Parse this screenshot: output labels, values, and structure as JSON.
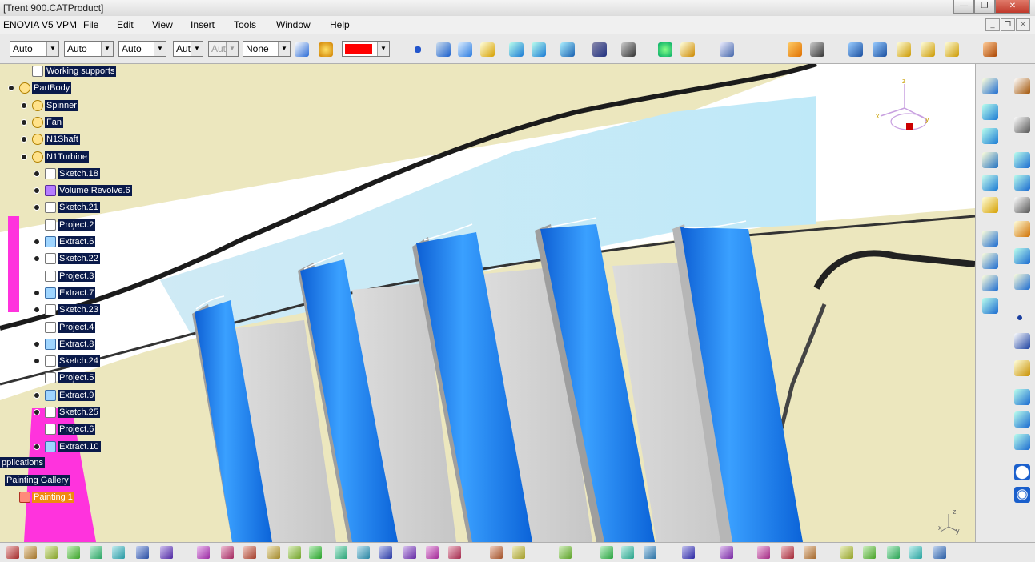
{
  "window": {
    "title": "[Trent 900.CATProduct]",
    "buttons": {
      "minimize": "—",
      "restore": "❐",
      "close": "✕"
    }
  },
  "menubar": {
    "app_name": "ENOVIA V5 VPM",
    "items": [
      "File",
      "Edit",
      "View",
      "Insert",
      "Tools",
      "Window",
      "Help"
    ],
    "mdi_buttons": [
      "_",
      "❐",
      "×"
    ]
  },
  "toolbar": {
    "combos": [
      {
        "value": "Auto",
        "enabled": true
      },
      {
        "value": "Auto",
        "enabled": true
      },
      {
        "value": "Auto",
        "enabled": true
      },
      {
        "value": "Aut",
        "enabled": true
      },
      {
        "value": "Aut",
        "enabled": false
      },
      {
        "value": "None",
        "enabled": true
      }
    ],
    "color_swatch": "#ff0000"
  },
  "tree": {
    "nodes": [
      {
        "label": "Working supports",
        "icon": "sketch-icon",
        "expanded": null
      },
      {
        "label": "PartBody",
        "icon": "gear-icon",
        "expanded": true
      },
      {
        "label": "Spinner",
        "icon": "gear-icon",
        "expanded": false
      },
      {
        "label": "Fan",
        "icon": "gear-icon",
        "expanded": false
      },
      {
        "label": "N1Shaft",
        "icon": "gear-icon",
        "expanded": false
      },
      {
        "label": "N1Turbine",
        "icon": "gear-icon",
        "expanded": true
      },
      {
        "label": "Sketch.18",
        "icon": "sketch-icon",
        "expanded": false
      },
      {
        "label": "Volume Revolve.6",
        "icon": "volume-icon",
        "expanded": false
      },
      {
        "label": "Sketch.21",
        "icon": "sketch-icon",
        "expanded": false
      },
      {
        "label": "Project.2",
        "icon": "sketch-icon",
        "expanded": null
      },
      {
        "label": "Extract.6",
        "icon": "extract-icon",
        "expanded": false
      },
      {
        "label": "Sketch.22",
        "icon": "sketch-icon",
        "expanded": false
      },
      {
        "label": "Project.3",
        "icon": "sketch-icon",
        "expanded": null
      },
      {
        "label": "Extract.7",
        "icon": "extract-icon",
        "expanded": false
      },
      {
        "label": "Sketch.23",
        "icon": "sketch-icon",
        "expanded": false
      },
      {
        "label": "Project.4",
        "icon": "sketch-icon",
        "expanded": null
      },
      {
        "label": "Extract.8",
        "icon": "extract-icon",
        "expanded": false
      },
      {
        "label": "Sketch.24",
        "icon": "sketch-icon",
        "expanded": false
      },
      {
        "label": "Project.5",
        "icon": "sketch-icon",
        "expanded": null
      },
      {
        "label": "Extract.9",
        "icon": "extract-icon",
        "expanded": false
      },
      {
        "label": "Sketch.25",
        "icon": "sketch-icon",
        "expanded": false
      },
      {
        "label": "Project.6",
        "icon": "sketch-icon",
        "expanded": null
      },
      {
        "label": "Extract.10",
        "icon": "extract-icon",
        "expanded": false
      }
    ],
    "applications_label": "pplications",
    "painting_gallery_label": "Painting Gallery",
    "painting_label": "Painting 1"
  },
  "compass": {
    "axes": [
      "z",
      "x",
      "y"
    ]
  },
  "corner_axis": {
    "labels": [
      "z",
      "x",
      "y"
    ]
  },
  "colors": {
    "blade_blue": "#1677e6",
    "blade_light": "#5ab8ff",
    "slot_grey": "#cfcfcf",
    "background_sketch": "#ece7be",
    "tree_highlight": "#0a1a4a",
    "selection_orange": "#f08a10"
  }
}
